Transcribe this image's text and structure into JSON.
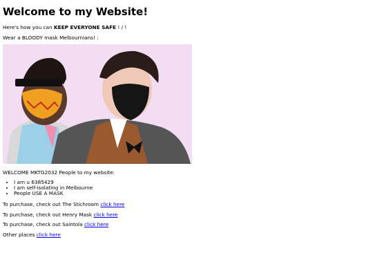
{
  "header": {
    "title": "Welcome to my Website!"
  },
  "intro": {
    "prefix": "Here's how you can ",
    "bold": "KEEP EVERYONE SAFE",
    "suffix": " ! / !"
  },
  "subtitle": "Wear a BLOODY mask Melbournians! :",
  "welcome": "WELCOME MKTG2032 People to my website:",
  "list": {
    "items": [
      "I am u 6385429",
      "I am self-isolating in Melbourne",
      "People USE A MASK"
    ]
  },
  "purchase": [
    {
      "text": "To purchase, check out The Stichroom ",
      "link": "click here"
    },
    {
      "text": "To purchase, check out Henry Mask ",
      "link": "click here"
    },
    {
      "text": "To purchase, check out Saintola ",
      "link": "click here"
    }
  ],
  "other": {
    "text": "Other places ",
    "link": "click here"
  },
  "colors": {
    "link": "#0000ee",
    "hero_background": "#f3ddf2"
  }
}
